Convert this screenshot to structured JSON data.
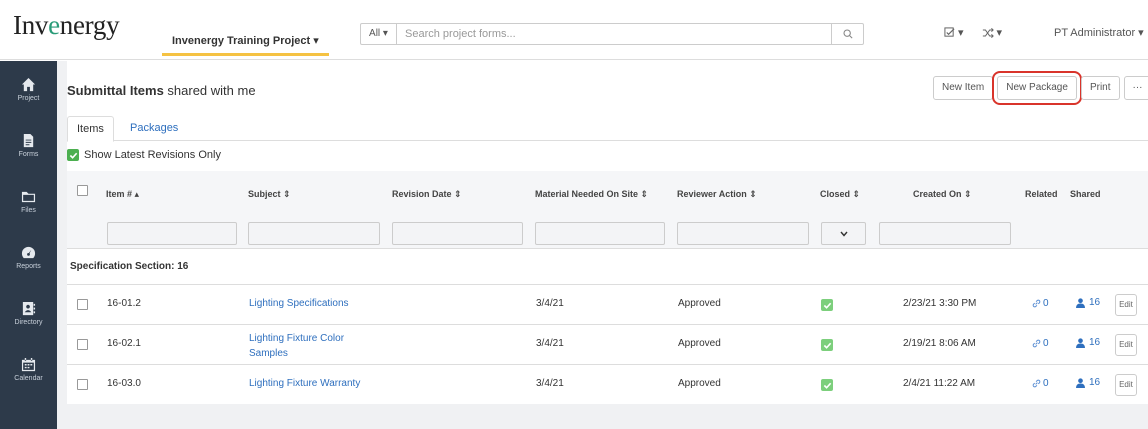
{
  "brand": {
    "logo_prefix": "Inv",
    "logo_accent": "e",
    "logo_suffix": "nergy"
  },
  "header": {
    "project": "Invenergy Training Project ▾",
    "search_scope": "All ▾",
    "search_placeholder": "Search project forms...",
    "tasks_caret": "▾",
    "workflow_caret": "▾",
    "user": "PT Administrator ▾"
  },
  "sidebar": {
    "items": [
      {
        "label": "Project",
        "icon": "home-icon"
      },
      {
        "label": "Forms",
        "icon": "document-icon"
      },
      {
        "label": "Files",
        "icon": "folder-icon"
      },
      {
        "label": "Reports",
        "icon": "dashboard-icon"
      },
      {
        "label": "Directory",
        "icon": "contact-book-icon"
      },
      {
        "label": "Calendar",
        "icon": "calendar-icon"
      }
    ]
  },
  "page": {
    "title_bold": "Submittal Items",
    "title_rest": " shared with me",
    "actions": {
      "new_item": "New Item",
      "new_package": "New Package",
      "print": "Print",
      "more": "···"
    },
    "tabs": {
      "items": "Items",
      "packages": "Packages"
    },
    "latest_revisions": "Show Latest Revisions Only"
  },
  "table": {
    "columns": {
      "item": "Item # ▴",
      "subject": "Subject ⇕",
      "revision_date": "Revision Date ⇕",
      "material": "Material Needed On Site ⇕",
      "reviewer": "Reviewer Action ⇕",
      "closed": "Closed ⇕",
      "created": "Created On ⇕",
      "related": "Related",
      "shared": "Shared"
    },
    "group": "Specification Section: 16",
    "rows": [
      {
        "item": "16-01.2",
        "subject": "Lighting Specifications",
        "material": "3/4/21",
        "reviewer": "Approved",
        "created": "2/23/21 3:30 PM",
        "related": "0",
        "shared": "16",
        "edit": "Edit"
      },
      {
        "item": "16-02.1",
        "subject": "Lighting Fixture Color Samples",
        "material": "3/4/21",
        "reviewer": "Approved",
        "created": "2/19/21 8:06 AM",
        "related": "0",
        "shared": "16",
        "edit": "Edit"
      },
      {
        "item": "16-03.0",
        "subject": "Lighting Fixture Warranty",
        "material": "3/4/21",
        "reviewer": "Approved",
        "created": "2/4/21 11:22 AM",
        "related": "0",
        "shared": "16",
        "edit": "Edit"
      }
    ]
  },
  "colors": {
    "sidebar": "#2d3a4a",
    "link": "#2e6fbe",
    "accent": "#f5c242",
    "highlight": "#d9342b",
    "check": "#4caf50"
  }
}
